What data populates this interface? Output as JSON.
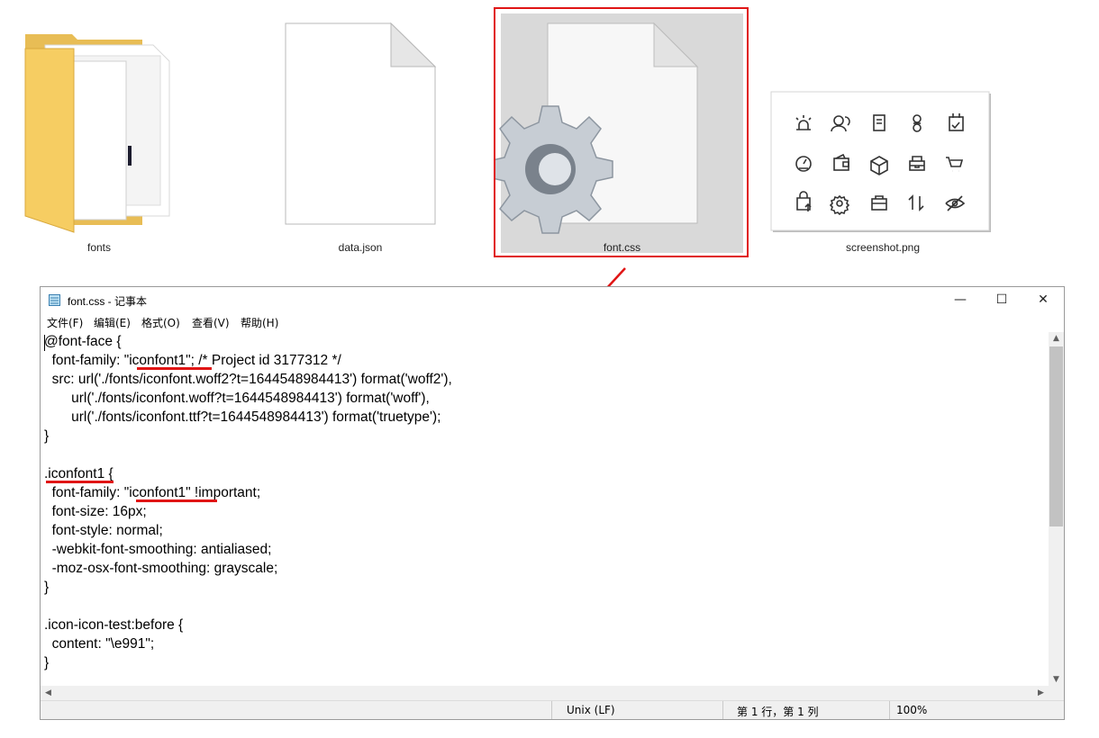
{
  "explorer": {
    "files": [
      {
        "name": "fonts",
        "icon": "folder-icon"
      },
      {
        "name": "data.json",
        "icon": "blank-file-icon"
      },
      {
        "name": "font.css",
        "icon": "css-settings-file-icon",
        "selected": true
      },
      {
        "name": "screenshot.png",
        "icon": "image-thumbnail-icon"
      }
    ],
    "accent": "#e01515"
  },
  "notepad": {
    "title": "font.css - 记事本",
    "menu": [
      "文件(F)",
      "编辑(E)",
      "格式(O)",
      "查看(V)",
      "帮助(H)"
    ],
    "window_controls": {
      "minimize": "—",
      "maximize": "☐",
      "close": "✕"
    },
    "code": [
      "@font-face {",
      "  font-family: \"iconfont1\"; /* Project id 3177312 */",
      "  src: url('./fonts/iconfont.woff2?t=1644548984413') format('woff2'),",
      "       url('./fonts/iconfont.woff?t=1644548984413') format('woff'),",
      "       url('./fonts/iconfont.ttf?t=1644548984413') format('truetype');",
      "}",
      "",
      ".iconfont1 {",
      "  font-family: \"iconfont1\" !important;",
      "  font-size: 16px;",
      "  font-style: normal;",
      "  -webkit-font-smoothing: antialiased;",
      "  -moz-osx-font-smoothing: grayscale;",
      "}",
      "",
      ".icon-icon-test:before {",
      "  content: \"\\e991\";",
      "}"
    ],
    "status": {
      "line_ending": "Unix (LF)",
      "position": "第 1 行，第 1 列",
      "zoom": "100%"
    }
  }
}
